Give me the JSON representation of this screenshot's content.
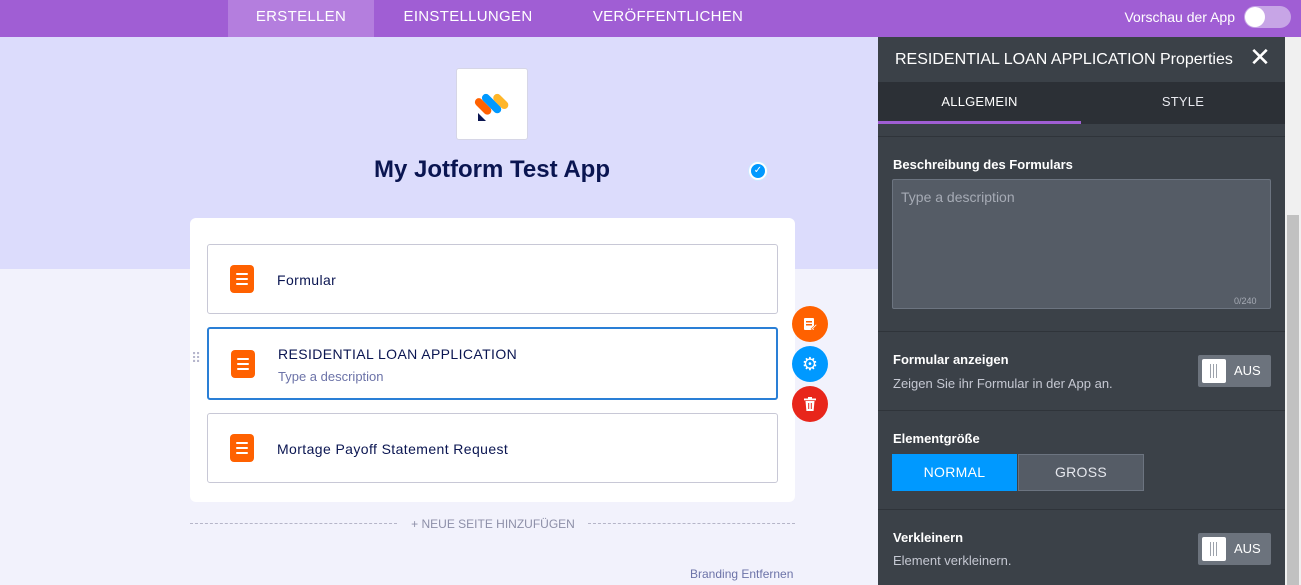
{
  "topbar": {
    "tabs": [
      {
        "label": "ERSTELLEN",
        "active": true
      },
      {
        "label": "EINSTELLUNGEN",
        "active": false
      },
      {
        "label": "VERÖFFENTLICHEN",
        "active": false
      }
    ],
    "preview_label": "Vorschau der App",
    "preview_toggle_on": false,
    "colors": {
      "bar": "#a05ed4",
      "active_tab": "#b47ede"
    }
  },
  "app": {
    "title": "My Jotform Test App",
    "verified_icon": "check-circle-icon",
    "logo_icon": "jotform-logo-icon"
  },
  "forms": [
    {
      "title": "Formular",
      "description": "",
      "icon": "form-icon",
      "selected": false
    },
    {
      "title": "RESIDENTIAL LOAN APPLICATION",
      "description": "Type a description",
      "icon": "form-icon",
      "selected": true
    },
    {
      "title": "Mortage Payoff Statement Request",
      "description": "",
      "icon": "form-icon",
      "selected": false
    }
  ],
  "item_actions": {
    "edit_icon": "edit-form-icon",
    "settings_icon": "gear-icon",
    "delete_icon": "trash-icon",
    "colors": {
      "edit": "#ff6100",
      "settings": "#0099ff",
      "delete": "#e8261b"
    }
  },
  "add_page_label": "+ NEUE SEITE HINZUFÜGEN",
  "branding_label": "Branding Entfernen",
  "panel": {
    "title": "RESIDENTIAL LOAN APPLICATION Properties",
    "close_icon": "close-icon",
    "tabs": [
      {
        "label": "ALLGEMEIN",
        "active": true
      },
      {
        "label": "STYLE",
        "active": false
      }
    ],
    "description": {
      "label": "Beschreibung des Formulars",
      "placeholder": "Type a description",
      "counter": "0/240"
    },
    "show_form": {
      "label": "Formular anzeigen",
      "sub": "Zeigen Sie ihr Formular in der App an.",
      "switch_label": "AUS"
    },
    "element_size": {
      "label": "Elementgröße",
      "options": [
        "NORMAL",
        "GROSS"
      ],
      "selected": "NORMAL"
    },
    "shrink": {
      "label": "Verkleinern",
      "sub": "Element verkleinern.",
      "switch_label": "AUS"
    }
  }
}
